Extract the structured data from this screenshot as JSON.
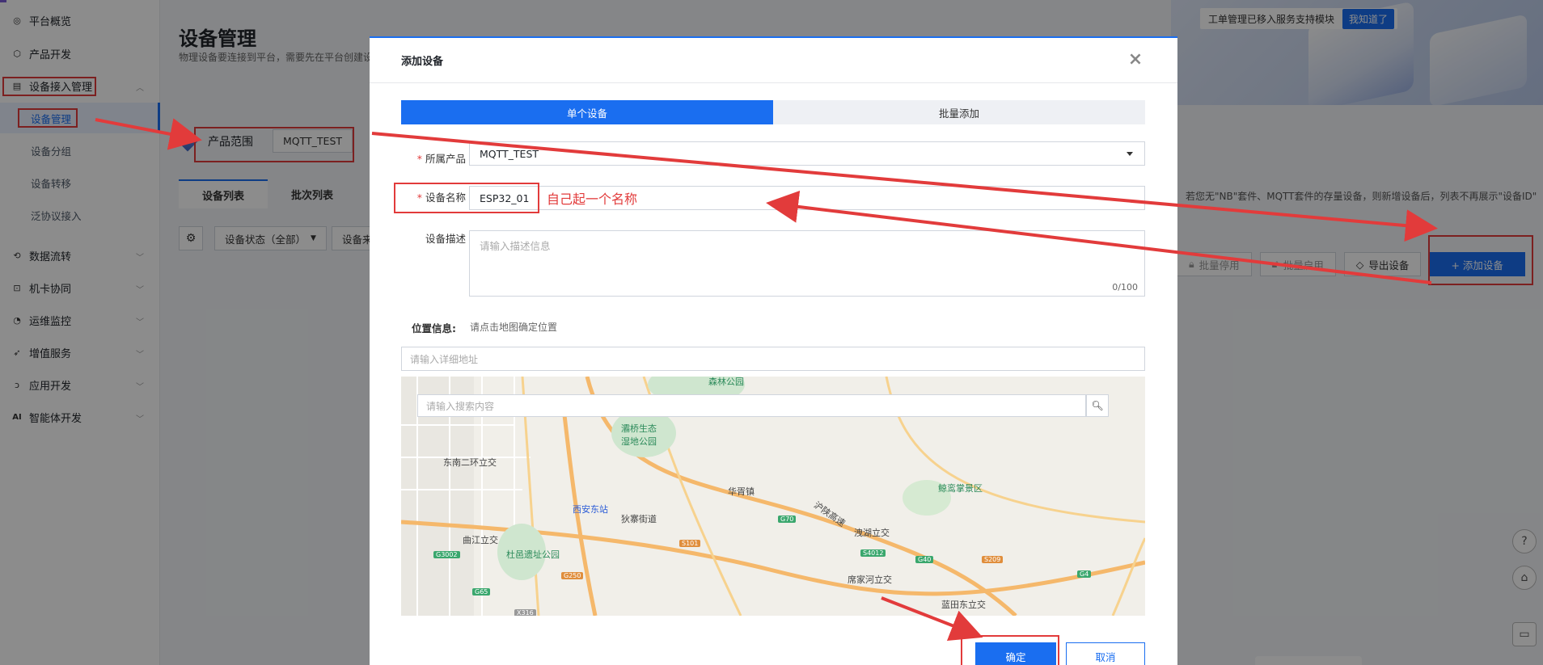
{
  "sidebar": {
    "items": [
      {
        "label": "平台概览",
        "icon": "gauge-icon"
      },
      {
        "label": "产品开发",
        "icon": "cube-icon"
      },
      {
        "label": "设备接入管理",
        "icon": "device-icon"
      },
      {
        "label": "数据流转",
        "icon": "flow-icon"
      },
      {
        "label": "机卡协同",
        "icon": "sim-icon"
      },
      {
        "label": "运维监控",
        "icon": "clock-icon"
      },
      {
        "label": "增值服务",
        "icon": "send-icon"
      },
      {
        "label": "应用开发",
        "icon": "code-icon"
      },
      {
        "label": "智能体开发",
        "icon": "ai-icon"
      }
    ],
    "subitems": [
      "设备管理",
      "设备分组",
      "设备转移",
      "泛协议接入"
    ],
    "ai_prefix": "AI"
  },
  "page": {
    "title": "设备管理",
    "desc": "物理设备要连接到平台，需要先在平台创建设"
  },
  "notice": {
    "text": "工单管理已移入服务支持模块",
    "button": "我知道了"
  },
  "scope": {
    "label": "产品范围",
    "value": "MQTT_TEST"
  },
  "list_tabs": [
    "设备列表",
    "批次列表"
  ],
  "filters": {
    "status": "设备状态（全部）",
    "more": "设备来"
  },
  "hint_right": "若您无\"NB\"套件、MQTT套件的存量设备，则新增设备后，列表不再展示\"设备ID\"",
  "actions": {
    "batch_disable": "批量停用",
    "batch_enable": "批量启用",
    "export": "导出设备",
    "add": "+ 添加设备"
  },
  "modal": {
    "title": "添加设备",
    "tabs": [
      "单个设备",
      "批量添加"
    ],
    "product_label": "所属产品",
    "product_value": "MQTT_TEST",
    "name_label": "设备名称",
    "name_value": "ESP32_01",
    "desc_label": "设备描述",
    "desc_placeholder": "请输入描述信息",
    "desc_counter": "0/100",
    "location_label": "位置信息:",
    "location_hint": "请点击地图确定位置",
    "address_placeholder": "请输入详细地址",
    "map_search_placeholder": "请输入搜索内容",
    "confirm": "确定",
    "cancel": "取消"
  },
  "annotation": {
    "text": "自己起一个名称",
    "color": "#e23b3b"
  },
  "map_labels": [
    "森林公园",
    "灞桥生态湿地公园",
    "东南二环立交",
    "华胥镇",
    "鲸鸾掌景区",
    "西安东站",
    "狄寨街道",
    "沪陕高速",
    "洩湖立交",
    "曲江立交",
    "杜邑遗址公园",
    "席家河立交",
    "蓝田东立交",
    "G70",
    "S101",
    "G40",
    "S4012",
    "S209",
    "G3002",
    "G65",
    "G4",
    "G250",
    "X316"
  ],
  "colors": {
    "primary": "#1a6ef0",
    "annotation": "#e23b3b"
  }
}
